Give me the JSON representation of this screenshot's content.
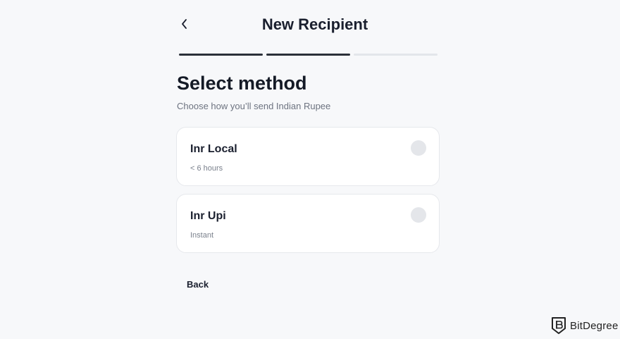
{
  "header": {
    "title": "New Recipient",
    "back_icon": "chevron-left-icon"
  },
  "progress": {
    "total_steps": 3,
    "completed_steps": 2
  },
  "main": {
    "heading": "Select method",
    "subheading": "Choose how you’ll send Indian Rupee",
    "methods": [
      {
        "name": "Inr Local",
        "eta": "< 6 hours",
        "selected": false
      },
      {
        "name": "Inr Upi",
        "eta": "Instant",
        "selected": false
      }
    ]
  },
  "footer": {
    "back_label": "Back"
  },
  "watermark": {
    "text": "BitDegree"
  },
  "colors": {
    "background": "#f7f8fa",
    "text": "#1a1f2e",
    "progress_done": "#2b3039",
    "progress_pending": "#e3e6ea",
    "radio": "#e4e6ea",
    "card_border": "#e6e8ec"
  }
}
